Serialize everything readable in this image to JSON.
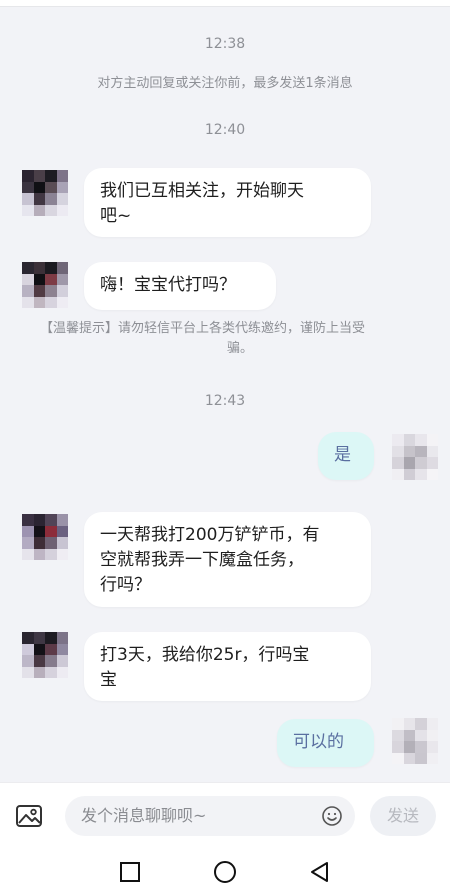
{
  "chat": {
    "times": [
      "12:38",
      "12:40",
      "12:43"
    ],
    "system_notice": "对方主动回复或关注你前，最多发送1条消息",
    "warning": {
      "line1": "【温馨提示】请勿轻信平台上各类代练邀约，谨防上当受",
      "line2": "骗。"
    },
    "messages": [
      {
        "from": "other",
        "line1": "我们已互相关注，开始聊天",
        "line2": "吧~"
      },
      {
        "from": "other",
        "line1": "嗨！宝宝代打吗？"
      },
      {
        "from": "me",
        "line1": "是"
      },
      {
        "from": "other",
        "line1": "一天帮我打200万铲铲币，有",
        "line2": "空就帮我弄一下魔盒任务，",
        "line3": "行吗？"
      },
      {
        "from": "other",
        "line1": "打3天，我给你25r，行吗宝",
        "line2": "宝"
      },
      {
        "from": "me",
        "line1": "可以的"
      }
    ]
  },
  "input_bar": {
    "placeholder": "发个消息聊聊呗~",
    "send_label": "发送",
    "image_icon": "image-icon",
    "emoji_icon": "smiley-icon"
  },
  "nav": {
    "recent_icon": "square-icon",
    "home_icon": "circle-icon",
    "back_icon": "triangle-back-icon"
  },
  "colors": {
    "background": "#f2f3f7",
    "bubble_other": "#ffffff",
    "bubble_me": "#dcf7f6",
    "bubble_me_text": "#5a6fa0",
    "muted_text": "#8e9096"
  }
}
